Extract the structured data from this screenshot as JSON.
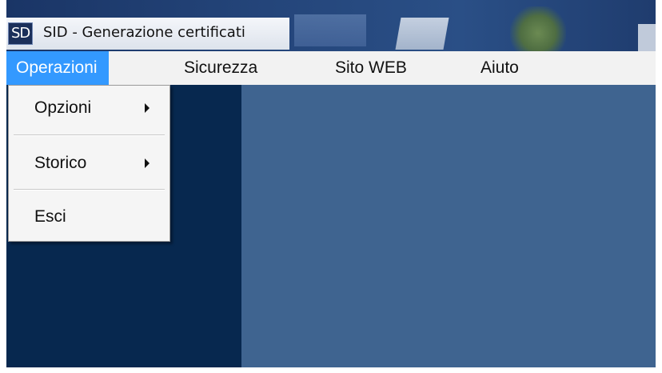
{
  "window": {
    "title": "SID - Generazione certificati",
    "icon_text": "SD",
    "icon": "app-logo-icon"
  },
  "menubar": {
    "items": [
      {
        "label": "Operazioni",
        "active": true
      },
      {
        "label": "Sicurezza"
      },
      {
        "label": "Sito WEB"
      },
      {
        "label": "Aiuto"
      }
    ]
  },
  "dropdown": {
    "items": [
      {
        "label": "Opzioni",
        "has_submenu": true,
        "submenu_icon": "submenu-arrow-icon"
      },
      {
        "label": "Storico",
        "has_submenu": true,
        "submenu_icon": "submenu-arrow-icon"
      },
      {
        "label": "Esci",
        "has_submenu": false
      }
    ]
  },
  "colors": {
    "menu_highlight": "#3399ff",
    "client_dark": "#07284f",
    "client_main": "#3f6490",
    "menubar_bg": "#f2f2f2"
  }
}
